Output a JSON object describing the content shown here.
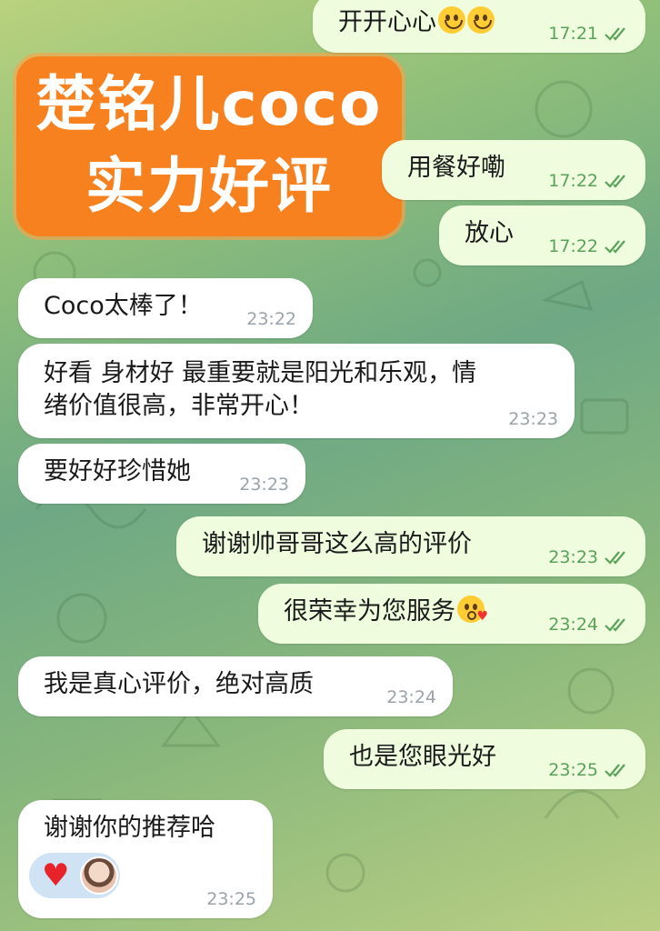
{
  "banner": {
    "line1": "楚铭儿coco",
    "line2": "实力好评"
  },
  "messages": [
    {
      "text": "开开心心",
      "time": "17:21",
      "emoji": "smile-emoji",
      "read": true
    },
    {
      "text": "用餐好嘞",
      "time": "17:22",
      "read": true
    },
    {
      "text": "放心",
      "time": "17:22",
      "read": true
    },
    {
      "text": "Coco太棒了！",
      "time": "23:22"
    },
    {
      "line1": "好看 身材好 最重要就是阳光和乐观，情",
      "line2": "绪价值很高，非常开心！",
      "time": "23:23"
    },
    {
      "text": "要好好珍惜她",
      "time": "23:23"
    },
    {
      "text": "谢谢帅哥哥这么高的评价",
      "time": "23:23",
      "read": true
    },
    {
      "text": "很荣幸为您服务",
      "time": "23:24",
      "emoji": "kiss-emoji",
      "read": true
    },
    {
      "text": "我是真心评价，绝对高质",
      "time": "23:24"
    },
    {
      "text": "也是您眼光好",
      "time": "23:25",
      "read": true
    },
    {
      "text": "谢谢你的推荐哈",
      "time": "23:25",
      "reactions": [
        "heart-icon",
        "avatar"
      ]
    }
  ],
  "colors": {
    "outgoing_bubble": "#effdde",
    "incoming_bubble": "#ffffff",
    "banner": "#f7801f",
    "check": "#5aa25a"
  }
}
